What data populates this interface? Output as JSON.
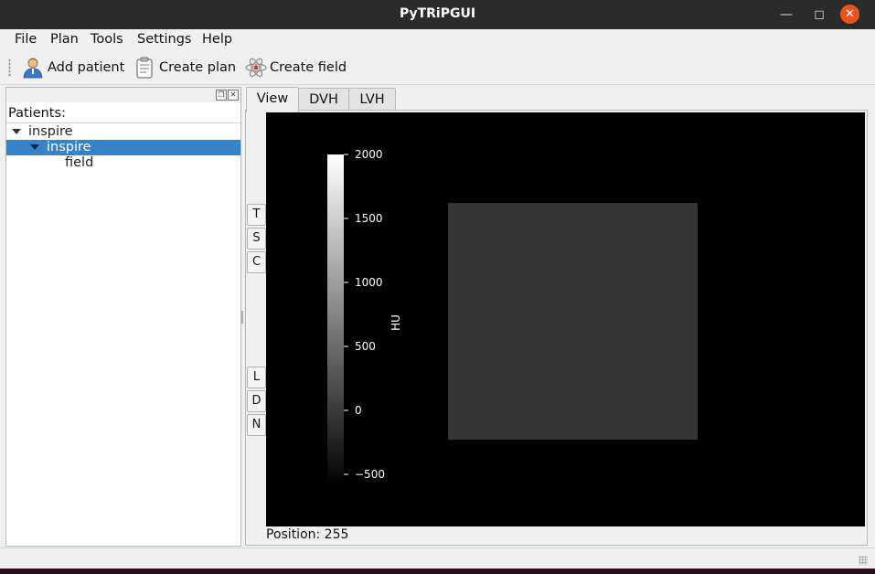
{
  "window": {
    "title": "PyTRiPGUI"
  },
  "menu": [
    "File",
    "Plan",
    "Tools",
    "Settings",
    "Help"
  ],
  "toolbar": {
    "add_patient": "Add patient",
    "create_plan": "Create plan",
    "create_field": "Create field"
  },
  "tree": {
    "header": "Patients:",
    "items": [
      {
        "label": "inspire",
        "level": 0,
        "expanded": true,
        "selected": false
      },
      {
        "label": "inspire",
        "level": 1,
        "expanded": true,
        "selected": true
      },
      {
        "label": "field",
        "level": 2,
        "expanded": false,
        "selected": false
      }
    ]
  },
  "tabs": [
    "View",
    "DVH",
    "LVH"
  ],
  "view_buttons_top": [
    "T",
    "S",
    "C"
  ],
  "view_buttons_bottom": [
    "L",
    "D",
    "N"
  ],
  "status": {
    "position": "Position: 255"
  },
  "colorbar": {
    "label": "HU",
    "min": -600,
    "max": 2000,
    "ticks": [
      "2000",
      "1500",
      "1000",
      "500",
      "0",
      "−500"
    ],
    "tick_values": [
      2000,
      1500,
      1000,
      500,
      0,
      -500
    ]
  },
  "image": {
    "background": "#000000",
    "square_color": "#353535"
  },
  "colors": {
    "accent": "#3584c9",
    "close_button": "#e95420"
  }
}
